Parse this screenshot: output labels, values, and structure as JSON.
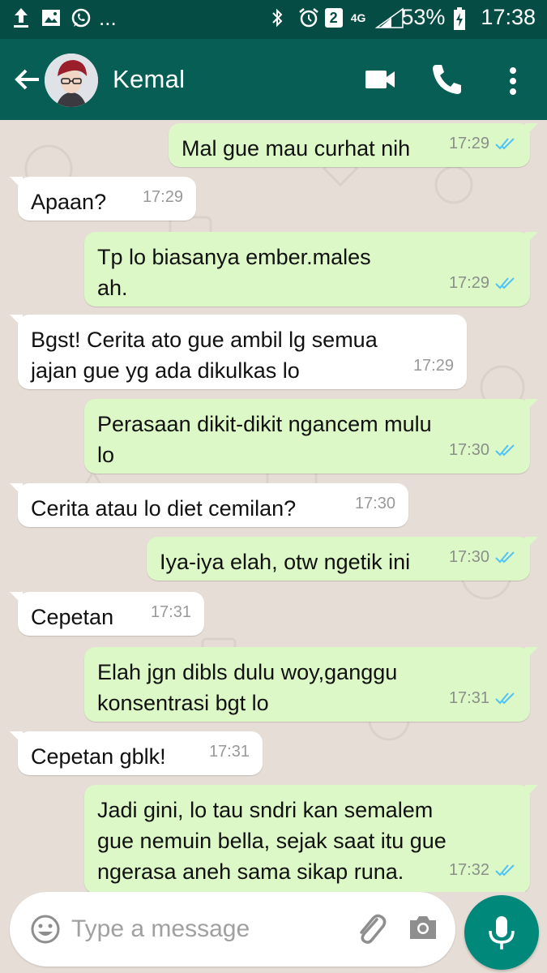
{
  "status_bar": {
    "dots": "...",
    "sim_badge": "2",
    "network": "4G",
    "battery": "53%",
    "time": "17:38",
    "icons": [
      "upload-icon",
      "image-icon",
      "whatsapp-icon",
      "bluetooth-icon",
      "alarm-icon",
      "signal-icon",
      "battery-icon"
    ]
  },
  "header": {
    "contact_name": "Kemal",
    "icons": [
      "back-arrow-icon",
      "avatar",
      "video-call-icon",
      "phone-icon",
      "more-vert-icon"
    ]
  },
  "messages": [
    {
      "dir": "out",
      "text": "Mal gue mau curhat nih",
      "time": "17:29",
      "read": true
    },
    {
      "dir": "in",
      "text": "Apaan?",
      "time": "17:29"
    },
    {
      "dir": "out",
      "text": "Tp lo biasanya ember.males\nah.",
      "time": "17:29",
      "read": true
    },
    {
      "dir": "in",
      "text": "Bgst! Cerita ato gue ambil lg semua\njajan gue yg ada dikulkas lo",
      "time": "17:29"
    },
    {
      "dir": "out",
      "text": "Perasaan dikit-dikit ngancem mulu\nlo",
      "time": "17:30",
      "read": true
    },
    {
      "dir": "in",
      "text": "Cerita atau lo diet cemilan?",
      "time": "17:30"
    },
    {
      "dir": "out",
      "text": "Iya-iya elah, otw ngetik ini",
      "time": "17:30",
      "read": true
    },
    {
      "dir": "in",
      "text": "Cepetan",
      "time": "17:31"
    },
    {
      "dir": "out",
      "text": "Elah jgn dibls dulu woy,ganggu\nkonsentrasi bgt lo",
      "time": "17:31",
      "read": true
    },
    {
      "dir": "in",
      "text": "Cepetan gblk!",
      "time": "17:31"
    },
    {
      "dir": "out",
      "text": "Jadi gini, lo tau sndri kan semalem\ngue nemuin bella, sejak saat itu gue\nngerasa aneh sama sikap runa.",
      "time": "17:32",
      "read": true
    }
  ],
  "input": {
    "placeholder": "Type a message",
    "value": ""
  },
  "colors": {
    "header": "#075e54",
    "status_bar": "#054d44",
    "outgoing_bubble": "#dcf8c6",
    "incoming_bubble": "#ffffff",
    "read_tick": "#4fc3f7",
    "mic_button": "#00897b",
    "chat_background": "#e6ded6"
  }
}
